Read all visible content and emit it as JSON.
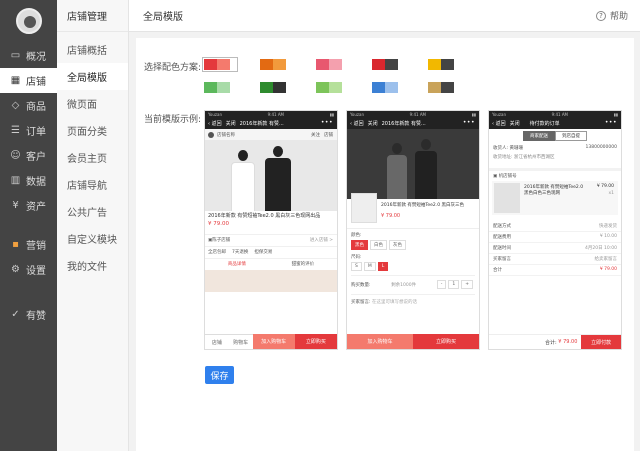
{
  "nav": {
    "items": [
      {
        "label": "概况",
        "icon": "monitor-icon"
      },
      {
        "label": "店铺",
        "icon": "store-icon",
        "active": true
      },
      {
        "label": "商品",
        "icon": "tag-icon"
      },
      {
        "label": "订单",
        "icon": "list-icon"
      },
      {
        "label": "客户",
        "icon": "user-icon"
      },
      {
        "label": "数据",
        "icon": "chart-icon"
      },
      {
        "label": "资产",
        "icon": "yen-icon"
      },
      {
        "label": "营销",
        "icon": "apps-icon"
      },
      {
        "label": "设置",
        "icon": "gear-icon"
      },
      {
        "label": "有赞",
        "icon": "thumb-icon"
      }
    ]
  },
  "sub": {
    "title": "店铺管理",
    "items": [
      "店铺概括",
      "全局模版",
      "微页面",
      "页面分类",
      "会员主页",
      "店铺导航",
      "公共广告",
      "自定义模块",
      "我的文件"
    ]
  },
  "top": {
    "title": "全局模版",
    "help": "帮助"
  },
  "content": {
    "scheme_label": "选择配色方案:",
    "preview_label": "当前模版示例:",
    "swatches": [
      [
        "#e4393c",
        "#f47a6d",
        "#ffffff"
      ],
      [
        "#e36a12",
        "#f29a3c",
        "#ffffff"
      ],
      [
        "#e8586f",
        "#f4a0ae",
        "#ffffff"
      ],
      [
        "#d9272e",
        "#444444",
        "#ffffff"
      ],
      [
        "#f2b800",
        "#444444",
        "#ffffff"
      ],
      [
        "#5cb85c",
        "#a8dba8",
        "#ffffff"
      ],
      [
        "#2e8b2e",
        "#333333",
        "#ffffff"
      ],
      [
        "#7dc45a",
        "#b5e09a",
        "#ffffff"
      ],
      [
        "#3c80d4",
        "#9cc0ec",
        "#ffffff"
      ],
      [
        "#c9a35a",
        "#444444",
        "#ffffff"
      ]
    ],
    "save_label": "保存"
  },
  "phone1": {
    "status": "Youzan",
    "time": "9:41 AM",
    "back": "返回",
    "close": "关闭",
    "title": "2016年新款 有赞...",
    "shop": "店铺名称",
    "shop_a": "关注",
    "shop_b": "店铺",
    "product": "2016年新款 有赞短袖Tee2.0 黑白灰三色现网出品",
    "price": "¥ 79.00",
    "row1": "陈子店铺",
    "row1_r": "进入店铺 >",
    "row2a": "全店包邮",
    "row2b": "7天退换",
    "row2c": "担保交易",
    "tab1": "商品详情",
    "tab2": "甜蜜的评价",
    "btn_home": "店铺",
    "btn_cart": "购物车",
    "btn_add": "加入购物车",
    "btn_buy": "立即购买"
  },
  "phone2": {
    "status": "Youzan",
    "time": "9:41 AM",
    "back": "返回",
    "close": "关闭",
    "title": "2016年新款 有赞...",
    "product": "2016年新款 有赞短袖Tee2.0 黑白灰三色",
    "price": "¥ 79.00",
    "color_label": "颜色:",
    "colors": [
      "黑色",
      "白色",
      "灰色"
    ],
    "size_label": "尺码:",
    "sizes": [
      "S",
      "M",
      "L"
    ],
    "qty_label": "购买数量:",
    "remain": "剩余1000件",
    "minus": "-",
    "qty": "1",
    "plus": "+",
    "note_label": "买家留言:",
    "note_ph": "在这里可填写想说的话",
    "btn_add": "加入购物车",
    "btn_buy": "立即购买"
  },
  "phone3": {
    "status": "Youzan",
    "time": "9:41 AM",
    "back": "返回",
    "close": "关闭",
    "title": "待付款的订单",
    "tab1": "商家配送",
    "tab2": "到店自提",
    "recv": "收货人: 黄珊珊",
    "phone": "13800000000",
    "addr": "收货地址: 浙江省杭州市西湖区",
    "store": "机店铺号",
    "item": "2016年新款 有赞短袖Tee2.0 黑色白色三色现网",
    "item_price": "¥ 79.00",
    "item_qty": "x1",
    "rows": [
      {
        "k": "配送方式",
        "v": "快递发货"
      },
      {
        "k": "配送费用",
        "v": "¥ 10.00"
      },
      {
        "k": "配送时间",
        "v": "4月20日 10:00"
      },
      {
        "k": "买家留言",
        "v": "给卖家留言"
      },
      {
        "k": "合计",
        "v": "¥ 79.00"
      }
    ],
    "total_label": "合计:",
    "total": "¥ 79.00",
    "pay": "立即付款"
  }
}
